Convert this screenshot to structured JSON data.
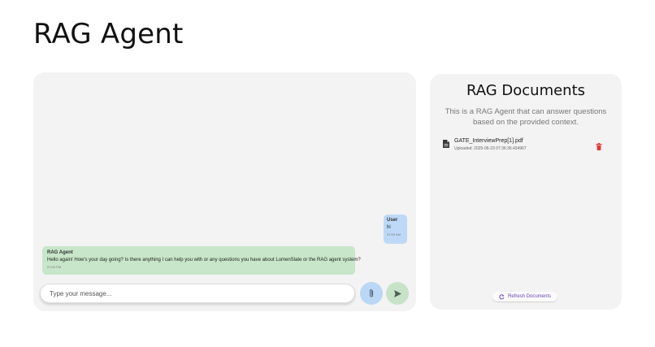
{
  "page": {
    "title": "RAG Agent"
  },
  "chat": {
    "messages": [
      {
        "role": "user",
        "sender": "User",
        "text": "hi",
        "time": "07:00 AM"
      },
      {
        "role": "agent",
        "sender": "RAG Agent",
        "text": "Hello again! How's your day going? Is there anything I can help you with or any questions you have about LumenSlate or the RAG agent system?",
        "time": "07:00 PM"
      }
    ],
    "input": {
      "placeholder": "Type your message...",
      "value": ""
    },
    "attach_icon": "paperclip-icon",
    "send_icon": "send-icon",
    "colors": {
      "user_bubble": "#bdd9f7",
      "agent_bubble": "#c8e6c9",
      "attach_button": "#bad7f5",
      "send_button": "#c6e3c7"
    }
  },
  "documents": {
    "title": "RAG Documents",
    "description": "This is a RAG Agent that can answer questions based on the provided context.",
    "items": [
      {
        "name": "GATE_InterviewPrep[1].pdf",
        "uploaded": "Uploaded: 2025-06-23 07:36:36.434967",
        "icon": "file-icon",
        "delete_icon": "trash-icon"
      }
    ],
    "refresh_label": "Refresh Documents",
    "refresh_icon": "refresh-icon",
    "colors": {
      "delete": "#e53935",
      "refresh_text": "#6a3fb5"
    }
  }
}
